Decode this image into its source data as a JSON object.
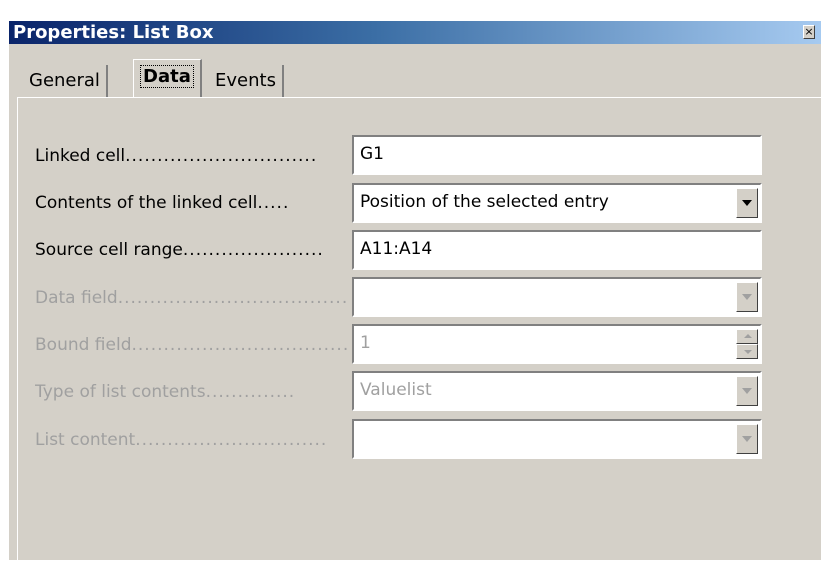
{
  "window": {
    "title": "Properties: List Box",
    "close_glyph": "×"
  },
  "tabs": [
    {
      "label": "General",
      "selected": false
    },
    {
      "label": "Data",
      "selected": true
    },
    {
      "label": "Events",
      "selected": false
    }
  ],
  "fields": {
    "linked_cell": {
      "label": "Linked cell",
      "dots": "..............................",
      "value": "G1",
      "enabled": true
    },
    "contents_linked": {
      "label": "Contents of the linked cell",
      "dots": ".....",
      "value": "Position of the selected entry",
      "enabled": true
    },
    "source_range": {
      "label": "Source cell range",
      "dots": "......................",
      "value": "A11:A14",
      "enabled": true
    },
    "data_field": {
      "label": "Data field",
      "dots": "....................................",
      "value": "",
      "enabled": false
    },
    "bound_field": {
      "label": "Bound field",
      "dots": "..................................",
      "value": "1",
      "enabled": false
    },
    "list_type": {
      "label": "Type of list contents",
      "dots": "..............",
      "value": "Valuelist",
      "enabled": false
    },
    "list_content": {
      "label": "List content",
      "dots": "..............................",
      "value": "",
      "enabled": false
    }
  },
  "icons": {
    "dropdown": "chevron-down-icon",
    "spin_up": "spin-up-icon",
    "spin_down": "spin-down-icon",
    "close": "close-icon"
  }
}
